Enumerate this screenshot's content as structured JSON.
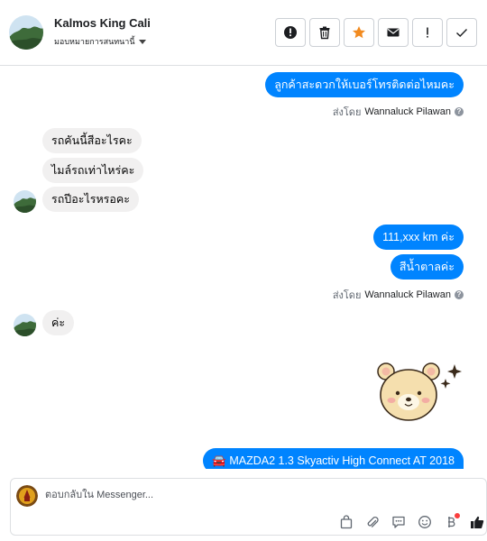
{
  "header": {
    "contact_name": "Kalmos King Cali",
    "assign_label": "มอบหมายการสนทนานี้",
    "actions": [
      {
        "name": "alert-button",
        "icon": "exclamation-circle-icon"
      },
      {
        "name": "delete-button",
        "icon": "trash-icon"
      },
      {
        "name": "star-button",
        "icon": "star-icon"
      },
      {
        "name": "email-button",
        "icon": "envelope-icon"
      },
      {
        "name": "spam-button",
        "icon": "exclamation-icon"
      },
      {
        "name": "done-button",
        "icon": "checkmark-icon"
      }
    ]
  },
  "messages": [
    {
      "id": "m1",
      "direction": "outgoing",
      "text": "ลูกค้าสะดวกให้เบอร์โทรติดต่อไหมคะ"
    },
    {
      "id": "s1",
      "type": "sent_by",
      "prefix": "ส่งโดย",
      "agent": "Wannaluck Pilawan"
    },
    {
      "id": "m2",
      "direction": "incoming",
      "text": "รถคันนี้สีอะไรคะ"
    },
    {
      "id": "m3",
      "direction": "incoming",
      "text": "ไมล์รถเท่าไหร่คะ"
    },
    {
      "id": "m4",
      "direction": "incoming",
      "text": "รถปีอะไรหรอคะ"
    },
    {
      "id": "m5",
      "direction": "outgoing",
      "text": "111,xxx  km  ค่ะ"
    },
    {
      "id": "m6",
      "direction": "outgoing",
      "text": "สีน้ำตาลค่ะ"
    },
    {
      "id": "s2",
      "type": "sent_by",
      "prefix": "ส่งโดย",
      "agent": "Wannaluck Pilawan"
    },
    {
      "id": "m7",
      "direction": "incoming",
      "text": "ค่ะ"
    },
    {
      "id": "m8",
      "direction": "outgoing",
      "type": "sticker",
      "sticker": "bear-sticker"
    },
    {
      "id": "m9",
      "direction": "outgoing",
      "text": "🚘 MAZDA2 1.3 Skyactiv High Connect AT 2018"
    }
  ],
  "composer": {
    "placeholder": "ตอบกลับใน Messenger...",
    "tools": [
      "shop-icon",
      "attach-icon",
      "saved-reply-icon",
      "emoji-icon",
      "payment-icon",
      "like-icon"
    ]
  },
  "colors": {
    "outgoing_bubble": "#0084ff",
    "incoming_bubble": "#f1f0f0",
    "star": "#f28b20",
    "notification_dot": "#fa3e3e"
  }
}
